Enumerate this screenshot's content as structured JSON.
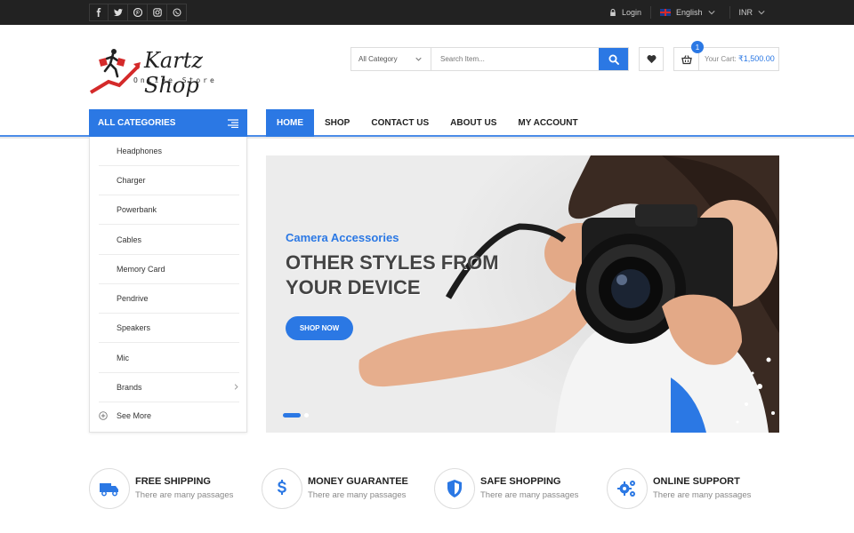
{
  "topbar": {
    "social": [
      {
        "icon": "facebook-icon",
        "glyph": "f"
      },
      {
        "icon": "twitter-icon",
        "glyph": "t"
      },
      {
        "icon": "pinterest-icon",
        "glyph": "p"
      },
      {
        "icon": "instagram-icon",
        "glyph": "i"
      },
      {
        "icon": "whatsapp-icon",
        "glyph": "w"
      }
    ],
    "login": "Login",
    "language": "English",
    "currency": "INR"
  },
  "header": {
    "logo_name": "Kartz Shop",
    "logo_sub": "Online Store",
    "category_select": "All Category",
    "search_placeholder": "Search Item...",
    "cart_count": "1",
    "cart_label": "Your Cart:",
    "cart_total": "₹1,500.00"
  },
  "nav": {
    "all_categories": "ALL CATEGORIES",
    "menu": [
      {
        "label": "HOME",
        "active": true
      },
      {
        "label": "SHOP",
        "active": false
      },
      {
        "label": "CONTACT US",
        "active": false
      },
      {
        "label": "ABOUT US",
        "active": false
      },
      {
        "label": "MY ACCOUNT",
        "active": false
      }
    ]
  },
  "categories": {
    "items": [
      "Headphones",
      "Charger",
      "Powerbank",
      "Cables",
      "Memory Card",
      "Pendrive",
      "Speakers",
      "Mic",
      "Brands"
    ],
    "see_more": "See More"
  },
  "banner": {
    "subtitle": "Camera Accessories",
    "title_line1": "OTHER STYLES FROM",
    "title_line2": "YOUR DEVICE",
    "button": "SHOP NOW"
  },
  "features": [
    {
      "title": "FREE SHIPPING",
      "subtitle": "There are many passages",
      "icon": "truck-icon"
    },
    {
      "title": "MONEY GUARANTEE",
      "subtitle": "There are many passages",
      "icon": "dollar-icon"
    },
    {
      "title": "SAFE SHOPPING",
      "subtitle": "There are many passages",
      "icon": "shield-icon"
    },
    {
      "title": "ONLINE SUPPORT",
      "subtitle": "There are many passages",
      "icon": "gears-icon"
    }
  ],
  "colors": {
    "accent": "#2b78e4",
    "topbar": "#222222"
  }
}
